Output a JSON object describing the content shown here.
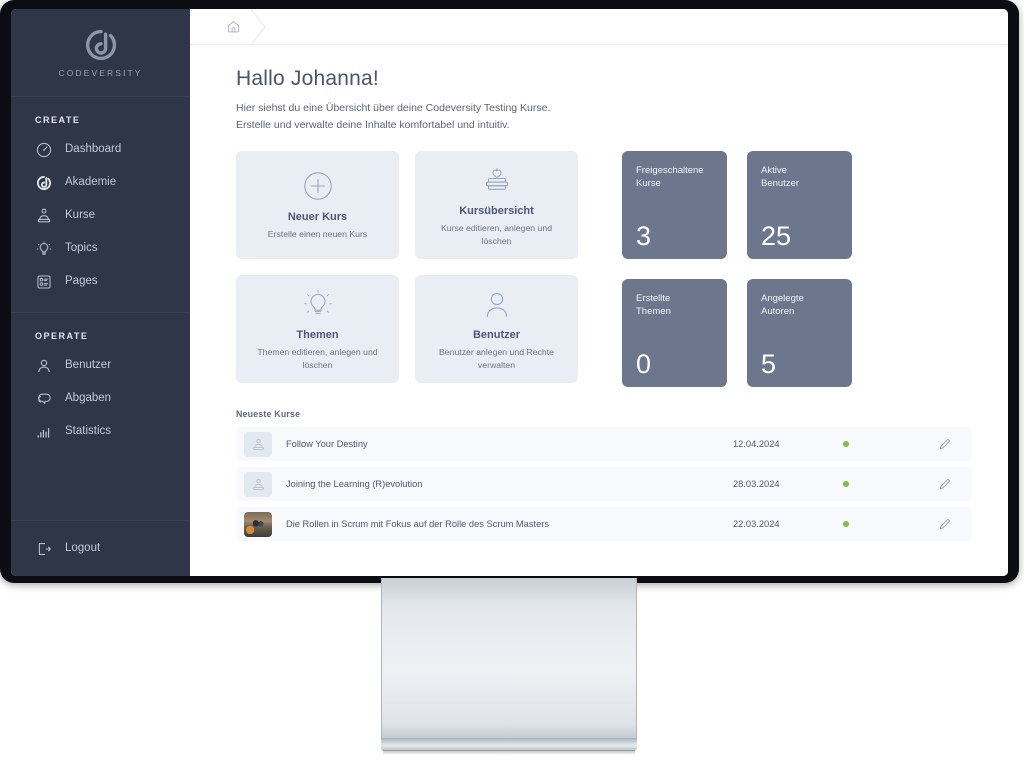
{
  "brand": {
    "name": "CODEVERSITY",
    "logo_icon": "codeversity-logo-icon"
  },
  "sidebar": {
    "sections": [
      {
        "heading": "CREATE",
        "items": [
          {
            "label": "Dashboard",
            "icon": "gauge-icon"
          },
          {
            "label": "Akademie",
            "icon": "codeversity-mark-icon"
          },
          {
            "label": "Kurse",
            "icon": "books-stack-icon"
          },
          {
            "label": "Topics",
            "icon": "lightbulb-icon"
          },
          {
            "label": "Pages",
            "icon": "list-box-icon"
          }
        ]
      },
      {
        "heading": "OPERATE",
        "items": [
          {
            "label": "Benutzer",
            "icon": "person-icon"
          },
          {
            "label": "Abgaben",
            "icon": "chat-bubbles-icon"
          },
          {
            "label": "Statistics",
            "icon": "bar-chart-icon"
          }
        ]
      }
    ],
    "logout": {
      "label": "Logout",
      "icon": "logout-icon"
    }
  },
  "breadcrumb": {
    "home_icon": "home-icon"
  },
  "header": {
    "title": "Hallo Johanna!",
    "subtitle_line1": "Hier siehst du eine Übersicht über deine Codeversity Testing Kurse.",
    "subtitle_line2": "Erstelle und verwalte deine Inhalte komfortabel und intuitiv."
  },
  "action_cards": [
    {
      "icon": "plus-circle-icon",
      "title": "Neuer Kurs",
      "desc": "Erstelle einen neuen Kurs"
    },
    {
      "icon": "apple-books-icon",
      "title": "Kursübersicht",
      "desc": "Kurse editieren, anlegen und löschen"
    },
    {
      "icon": "lightbulb-icon",
      "title": "Themen",
      "desc": "Themen editieren, anlegen und löschen"
    },
    {
      "icon": "person-icon",
      "title": "Benutzer",
      "desc": "Benutzer anlegen und Rechte verwalten"
    }
  ],
  "stat_cards": [
    {
      "label": "Freigeschaltene\nKurse",
      "value": "3"
    },
    {
      "label": "Aktive\nBenutzer",
      "value": "25"
    },
    {
      "label": "Erstellte\nThemen",
      "value": "0"
    },
    {
      "label": "Angelegte\nAutoren",
      "value": "5"
    }
  ],
  "courses": {
    "heading": "Neueste Kurse",
    "rows": [
      {
        "name": "Follow Your Destiny",
        "date": "12.04.2024",
        "status": "active",
        "thumb": "placeholder",
        "edit_icon": "pencil-icon"
      },
      {
        "name": "Joining the Learning (R)evolution",
        "date": "28.03.2024",
        "status": "active",
        "thumb": "placeholder",
        "edit_icon": "pencil-icon"
      },
      {
        "name": "Die Rollen in Scrum mit Fokus auf der Rolle des Scrum Masters",
        "date": "22.03.2024",
        "status": "active",
        "thumb": "photo",
        "edit_icon": "pencil-icon"
      }
    ]
  },
  "colors": {
    "sidebar_bg": "#2e3647",
    "stat_tile": "#6c778d",
    "action_tile": "#e9eef4",
    "row_bg": "#f7f9fc",
    "status_green": "#7ec13d",
    "title_text": "#4a546b"
  }
}
